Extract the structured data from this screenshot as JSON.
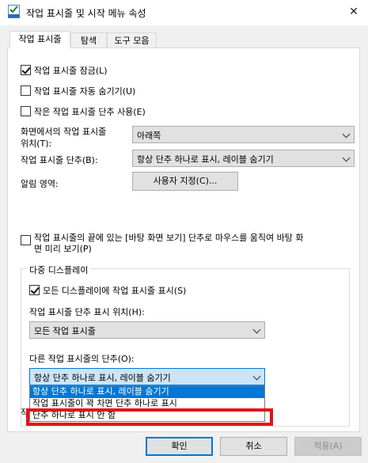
{
  "window": {
    "title": "작업 표시줄 및 시작 메뉴 속성",
    "close_glyph": "✕"
  },
  "tabs": [
    {
      "label": "작업 표시줄",
      "active": true
    },
    {
      "label": "탐색",
      "active": false
    },
    {
      "label": "도구 모음",
      "active": false
    }
  ],
  "options": {
    "lock_taskbar": {
      "label": "작업 표시줄 잠금(L)",
      "checked": true
    },
    "auto_hide": {
      "label": "작업 표시줄 자동 숨기기(U)",
      "checked": false
    },
    "small_buttons": {
      "label": "작은 작업 표시줄 단추 사용(E)",
      "checked": false
    }
  },
  "location": {
    "label_line1": "화면에서의 작업 표시줄",
    "label_line2": "위치(T):",
    "value": "아래쪽"
  },
  "buttons_combine": {
    "label": "작업 표시줄 단추(B):",
    "value": "항상 단추 하나로 표시, 레이블 숨기기"
  },
  "notification": {
    "label": "알림 영역:",
    "button_label": "사용자 지정(C)..."
  },
  "peek": {
    "label_line1": "작업 표시줄의 끝에 있는 [바탕 화면 보기] 단추로 마우스를 움직여 바탕 화",
    "label_line2": "면 미리 보기(P)",
    "checked": false
  },
  "multi_display": {
    "group_title": "다중 디스플레이",
    "show_all": {
      "label": "모든 디스플레이에 작업 표시줄 표시(S)",
      "checked": true
    },
    "show_buttons_on_label": "작업 표시줄 단추 표시 위치(H):",
    "show_buttons_on_value": "모든 작업 표시줄",
    "other_buttons_label": "다른 작업 표시줄의 단추(O):",
    "other_buttons_value": "항상 단추 하나로 표시, 레이블 숨기기",
    "dropdown_options": [
      "항상 단추 하나로 표시, 레이블 숨기기",
      "작업 표시줄이 꽉 차면 단추 하나로 표시",
      "단추 하나로 표시 안 함"
    ],
    "selected_index": 0
  },
  "hidden_partial_label": "작",
  "footer": {
    "ok": "확인",
    "cancel": "취소",
    "apply": "적용(A)"
  },
  "colors": {
    "accent": "#0078d7",
    "highlight_box": "#e8101a"
  }
}
